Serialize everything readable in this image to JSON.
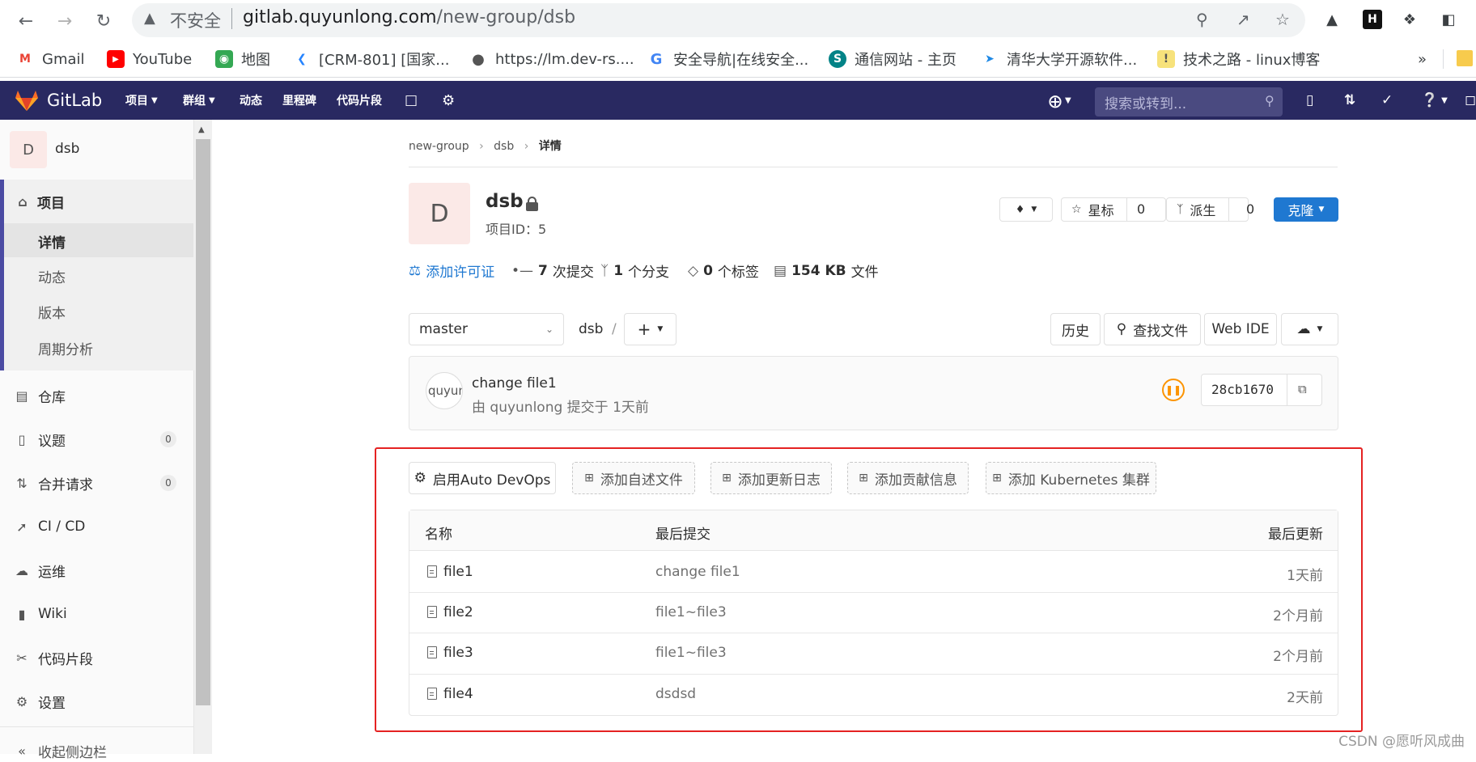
{
  "browser": {
    "insecure_label": "不安全",
    "url_host": "gitlab.quyunlong.com",
    "url_path": "/new-group/dsb",
    "bookmarks": [
      {
        "label": "Gmail",
        "icon": "gmail-icon"
      },
      {
        "label": "YouTube",
        "icon": "youtube-icon"
      },
      {
        "label": "地图",
        "icon": "maps-icon"
      },
      {
        "label": "[CRM-801] [国家...",
        "icon": "jira-icon"
      },
      {
        "label": "https://lm.dev-rs....",
        "icon": "globe-icon"
      },
      {
        "label": "安全导航|在线安全...",
        "icon": "google-icon"
      },
      {
        "label": "通信网站 - 主页",
        "icon": "sharepoint-icon"
      },
      {
        "label": "清华大学开源软件...",
        "icon": "tuna-icon"
      },
      {
        "label": "技术之路 - linux博客",
        "icon": "blog-icon"
      }
    ],
    "more_bookmarks": "»"
  },
  "header": {
    "logo_text": "GitLab",
    "nav": [
      "项目",
      "群组",
      "动态",
      "里程碑",
      "代码片段"
    ],
    "search_placeholder": "搜索或转到..."
  },
  "sidebar": {
    "project_avatar": "D",
    "project_name": "dsb",
    "section_label": "项目",
    "sub_items": [
      "详情",
      "动态",
      "版本",
      "周期分析"
    ],
    "items": [
      {
        "label": "仓库",
        "icon": "repository-icon"
      },
      {
        "label": "议题",
        "icon": "issues-icon",
        "count": "0"
      },
      {
        "label": "合并请求",
        "icon": "merge-request-icon",
        "count": "0"
      },
      {
        "label": "CI / CD",
        "icon": "rocket-icon"
      },
      {
        "label": "运维",
        "icon": "cloud-gear-icon"
      },
      {
        "label": "Wiki",
        "icon": "book-icon"
      },
      {
        "label": "代码片段",
        "icon": "scissors-icon"
      },
      {
        "label": "设置",
        "icon": "gear-icon"
      }
    ],
    "collapse_label": "收起侧边栏"
  },
  "breadcrumb": [
    "new-group",
    "dsb",
    "详情"
  ],
  "project": {
    "avatar": "D",
    "name": "dsb",
    "id_label": "项目ID：5",
    "star_label": "星标",
    "star_count": "0",
    "fork_label": "派生",
    "fork_count": "0",
    "clone_label": "克隆"
  },
  "stats": {
    "license": "添加许可证",
    "commits_num": "7",
    "commits_label": "次提交",
    "branches_num": "1",
    "branches_label": "个分支",
    "tags_num": "0",
    "tags_label": "个标签",
    "size_num": "154 KB",
    "size_label": "文件"
  },
  "tree": {
    "branch": "master",
    "path": "dsb",
    "path_sep": "/",
    "history": "历史",
    "find_file": "查找文件",
    "web_ide": "Web IDE"
  },
  "last_commit": {
    "avatar_alt": "quyun",
    "title": "change file1",
    "meta": "由 quyunlong 提交于 1天前",
    "sha": "28cb1670"
  },
  "actions": [
    "启用Auto DevOps",
    "添加自述文件",
    "添加更新日志",
    "添加贡献信息",
    "添加 Kubernetes 集群"
  ],
  "files": {
    "columns": [
      "名称",
      "最后提交",
      "最后更新"
    ],
    "rows": [
      {
        "name": "file1",
        "commit": "change file1",
        "updated": "1天前"
      },
      {
        "name": "file2",
        "commit": "file1~file3",
        "updated": "2个月前"
      },
      {
        "name": "file3",
        "commit": "file1~file3",
        "updated": "2个月前"
      },
      {
        "name": "file4",
        "commit": "dsdsd",
        "updated": "2天前"
      }
    ]
  },
  "watermark": "CSDN @愿听风成曲",
  "colors": {
    "header": "#292961",
    "primary": "#1f78d1",
    "highlight_border": "#e52222"
  }
}
